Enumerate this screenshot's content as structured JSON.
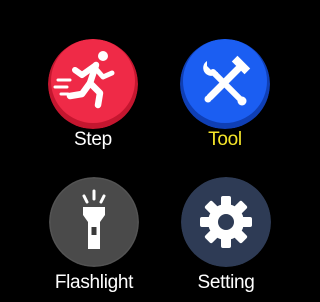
{
  "apps": [
    {
      "id": "step",
      "label": "Step",
      "icon": "running-person-icon",
      "color": "#ef2a47",
      "label_color": "#ffffff"
    },
    {
      "id": "tool",
      "label": "Tool",
      "icon": "hammer-wrench-icon",
      "color": "#1b5ef2",
      "label_color": "#f6e62a"
    },
    {
      "id": "flashlight",
      "label": "Flashlight",
      "icon": "flashlight-icon",
      "color": "#3a3a3a",
      "label_color": "#ffffff"
    },
    {
      "id": "setting",
      "label": "Setting",
      "icon": "gear-icon",
      "color": "#253148",
      "label_color": "#ffffff"
    }
  ]
}
